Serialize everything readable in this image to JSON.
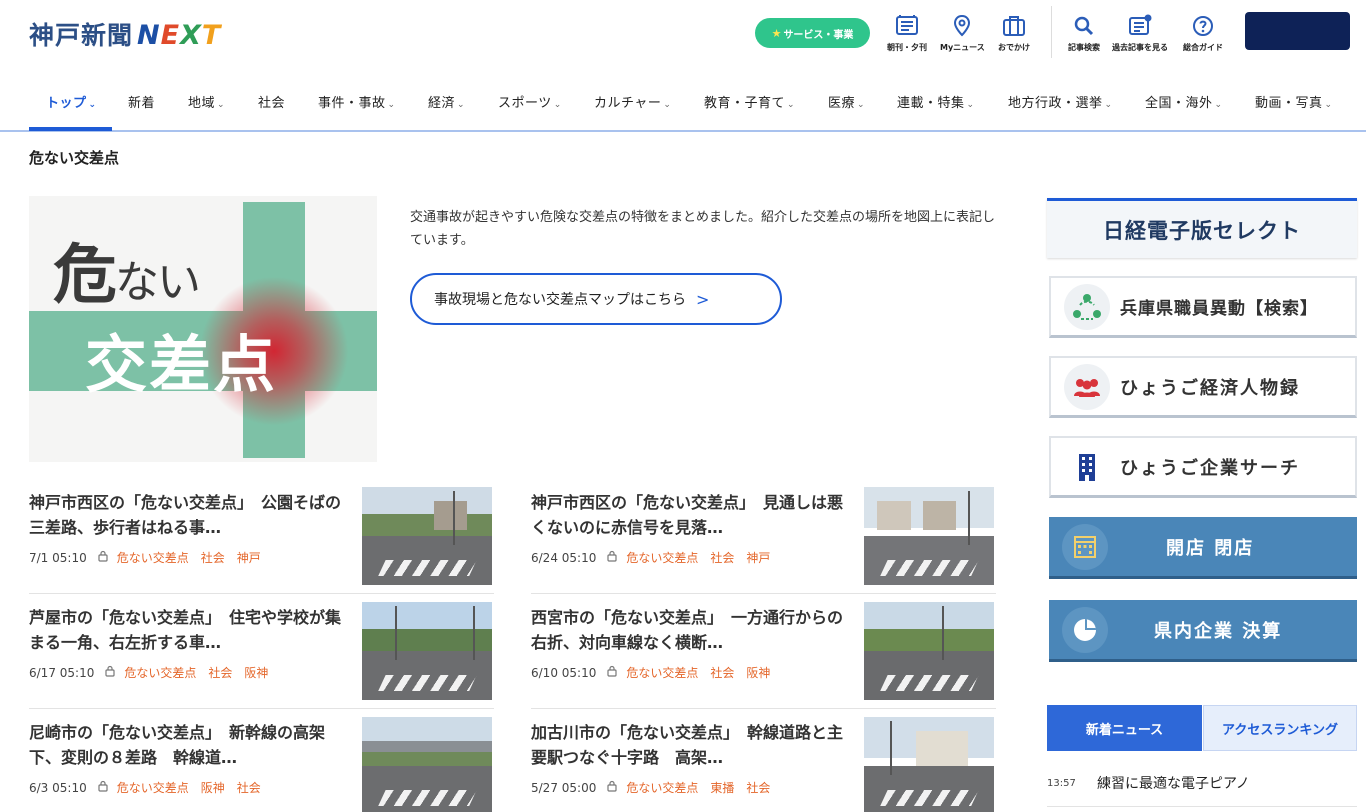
{
  "header": {
    "logo_jp": "神戸新聞",
    "logo_next": [
      "N",
      "E",
      "X",
      "T"
    ],
    "service_label": "サービス・事業",
    "icons": [
      {
        "label": "朝刊・夕刊",
        "icon": "newspaper-icon"
      },
      {
        "label": "Myニュース",
        "icon": "location-pin-icon"
      },
      {
        "label": "おでかけ",
        "icon": "suitcase-icon"
      },
      {
        "label": "記事検索",
        "icon": "search-icon"
      },
      {
        "label": "過去記事を見る",
        "icon": "past-articles-icon"
      },
      {
        "label": "総合ガイド",
        "icon": "help-icon"
      }
    ]
  },
  "nav": {
    "items": [
      "トップ",
      "新着",
      "地域",
      "社会",
      "事件・事故",
      "経済",
      "スポーツ",
      "カルチャー",
      "教育・子育て",
      "医療",
      "連載・特集",
      "地方行政・選挙",
      "全国・海外",
      "動画・写真"
    ]
  },
  "page": {
    "title": "危ない交差点",
    "hero_line1_big": "危",
    "hero_line1_small": "ない",
    "hero_line2": "交差点",
    "description": "交通事故が起きやすい危険な交差点の特徴をまとめました。紹介した交差点の場所を地図上に表記しています。",
    "map_button": "事故現場と危ない交差点マップはこちら",
    "map_button_arrow": ">"
  },
  "articles": [
    {
      "title": "神戸市西区の「危ない交差点」　公園そばの三差路、歩行者はねる事…",
      "time": "7/1 05:10",
      "tags": [
        "危ない交差点",
        "社会",
        "神戸"
      ]
    },
    {
      "title": "神戸市西区の「危ない交差点」　見通しは悪くないのに赤信号を見落…",
      "time": "6/24 05:10",
      "tags": [
        "危ない交差点",
        "社会",
        "神戸"
      ]
    },
    {
      "title": "芦屋市の「危ない交差点」　住宅や学校が集まる一角、右左折する車…",
      "time": "6/17 05:10",
      "tags": [
        "危ない交差点",
        "社会",
        "阪神"
      ]
    },
    {
      "title": "西宮市の「危ない交差点」　一方通行からの右折、対向車線なく横断…",
      "time": "6/10 05:10",
      "tags": [
        "危ない交差点",
        "社会",
        "阪神"
      ]
    },
    {
      "title": "尼崎市の「危ない交差点」　新幹線の高架下、変則の８差路　幹線道…",
      "time": "6/3 05:10",
      "tags": [
        "危ない交差点",
        "阪神",
        "社会"
      ]
    },
    {
      "title": "加古川市の「危ない交差点」　幹線道路と主要駅つなぐ十字路　高架…",
      "time": "5/27 05:00",
      "tags": [
        "危ない交差点",
        "東播",
        "社会"
      ]
    }
  ],
  "sidebar": {
    "nikkei": "日経電子版セレクト",
    "links": [
      {
        "label": "兵庫県職員異動【検索】",
        "icon": "people-network-icon"
      },
      {
        "label": "ひょうご経済人物録",
        "icon": "people-group-icon"
      },
      {
        "label": "ひょうご企業サーチ",
        "icon": "building-icon"
      },
      {
        "label": "開店 閉店",
        "icon": "storefront-icon"
      },
      {
        "label": "県内企業 決算",
        "icon": "pie-chart-icon"
      }
    ],
    "tabs": [
      "新着ニュース",
      "アクセスランキング"
    ],
    "news": [
      {
        "time": "13:57",
        "headline": "練習に最適な電子ピアノ"
      }
    ]
  },
  "colors": {
    "accent": "#1e5bd6",
    "service_green": "#2fc58c",
    "tag_orange": "#e4662a",
    "login_navy": "#0e2257",
    "side_blue": "#4a86b8"
  }
}
